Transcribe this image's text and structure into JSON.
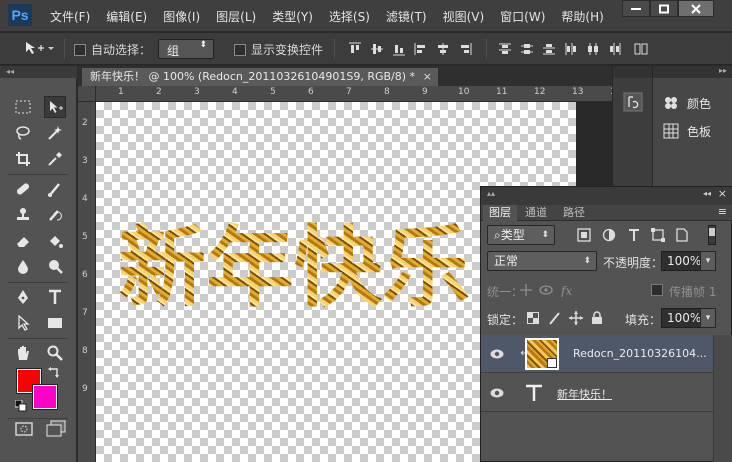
{
  "app": {
    "logo": "Ps"
  },
  "menu": [
    "文件(F)",
    "编辑(E)",
    "图像(I)",
    "图层(L)",
    "类型(Y)",
    "选择(S)",
    "滤镜(T)",
    "视图(V)",
    "窗口(W)",
    "帮助(H)"
  ],
  "options": {
    "auto_select_label": "自动选择：",
    "auto_select_value": "组",
    "show_transform_label": "显示变换控件"
  },
  "document": {
    "tab_title": "新年快乐！ @ 100% (Redocn_20110326104901S9, RGB/8) *",
    "close": "×",
    "canvas_text": "新年快乐"
  },
  "rulers": {
    "h_ticks": [
      "1",
      "2",
      "3",
      "4",
      "5",
      "6",
      "7",
      "8",
      "9",
      "10",
      "11",
      "12",
      "13",
      "14",
      "15"
    ],
    "v_ticks": [
      "2",
      "3",
      "4",
      "5",
      "6",
      "7",
      "8",
      "9"
    ]
  },
  "dock": {
    "items": [
      {
        "label": "颜色",
        "icon": "palette-icon"
      },
      {
        "label": "色板",
        "icon": "swatches-grid-icon"
      }
    ]
  },
  "layers_panel": {
    "tabs": [
      "图层",
      "通道",
      "路径"
    ],
    "filter_kind": "类型",
    "blend_mode": "正常",
    "opacity_label": "不透明度：",
    "opacity_value": "100%",
    "unify_label": "统一：",
    "propagate_label": "传播帧 1",
    "lock_label": "锁定：",
    "fill_label": "填充：",
    "fill_value": "100%",
    "layers": [
      {
        "name": "Redocn_20110326104...",
        "type": "image",
        "selected": true,
        "clipped": true
      },
      {
        "name": "新年快乐！",
        "type": "text",
        "selected": false
      }
    ]
  },
  "colors": {
    "foreground": "#ff0000",
    "background": "#ff00c8",
    "selected_layer": "#4f5868"
  }
}
